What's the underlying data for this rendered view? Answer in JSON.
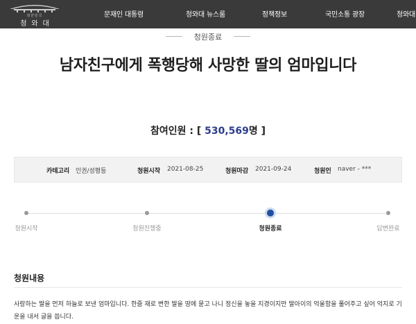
{
  "header": {
    "logo_small": "대한민국",
    "logo_title": "청와대",
    "nav": [
      "문재인 대통령",
      "청와대 뉴스룸",
      "정책정보",
      "국민소통 광장",
      "청와대"
    ]
  },
  "status": "청원종료",
  "title": "남자친구에게 폭행당해 사망한 딸의 엄마입니다",
  "participants": {
    "label": "참여인원 :",
    "open": "[",
    "value": "530,569",
    "unit": "명",
    "close": "]"
  },
  "info": {
    "category_label": "카테고리",
    "category_value": "인권/성평등",
    "start_label": "청원시작",
    "start_value": "2021-08-25",
    "end_label": "청원마감",
    "end_value": "2021-09-24",
    "petitioner_label": "청원인",
    "petitioner_value": "naver - ***"
  },
  "progress": {
    "steps": [
      "청원시작",
      "청원진행중",
      "청원종료",
      "답변완료"
    ],
    "active_index": 2
  },
  "content": {
    "heading": "청원내용",
    "text": "사랑하는 딸을 먼저 하늘로 보낸 엄마입니다. 한줌 재로 변한 딸을 땅에 묻고 나니 정신을 놓을 지경이지만 딸아이의 억울함을 풀어주고 싶어 억지로 기운을 내서 글을 씁니다."
  },
  "colors": {
    "topbar": "#3a3a3a",
    "accent": "#2c3e8c",
    "progress_active": "#1e50a0"
  }
}
